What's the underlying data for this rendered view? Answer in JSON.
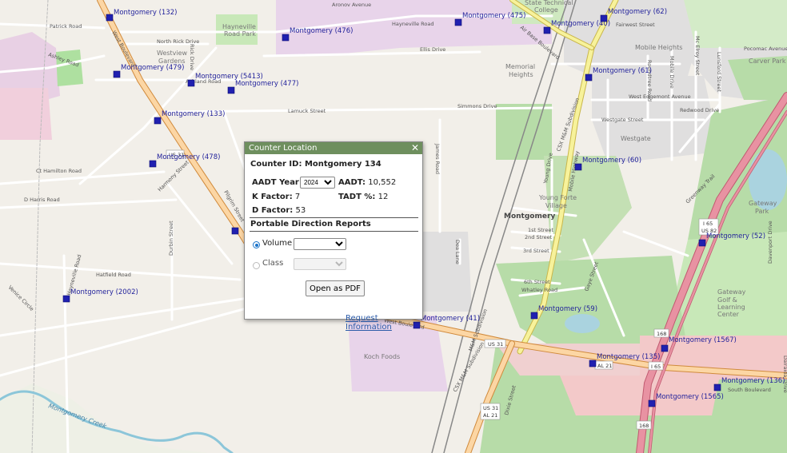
{
  "popup": {
    "title": "Counter Location",
    "close_symbol": "✕",
    "counter_id_label": "Counter ID:",
    "counter_id_value": "Montgomery 134",
    "aadt_year_label": "AADT Year:",
    "aadt_year_selected": "2024",
    "aadt_label": "AADT:",
    "aadt_value": "10,552",
    "k_factor_label": "K Factor:",
    "k_factor_value": "7",
    "tadt_label": "TADT %:",
    "tadt_value": "12",
    "d_factor_label": "D Factor:",
    "d_factor_value": "53",
    "section_title": "Portable Direction Reports",
    "volume_label": "Volume",
    "volume_checked": true,
    "class_label": "Class",
    "class_checked": false,
    "volume_selected": "",
    "class_selected": "",
    "pdf_button_label": "Open as PDF",
    "request_link_label": "Request Information"
  },
  "map": {
    "counters": [
      "Montgomery (132)",
      "Montgomery (476)",
      "Montgomery (475)",
      "Montgomery (40)",
      "Montgomery (62)",
      "Montgomery (479)",
      "Montgomery (5413)",
      "Montgomery (477)",
      "Montgomery (61)",
      "Montgomery (133)",
      "Montgomery (478)",
      "Montgomery (60)",
      "Montgomery (52)",
      "Montgomery (2002)",
      "Montgomery (59)",
      "Montgomery (41)",
      "Montgomery (1567)",
      "Montgomery (135)",
      "Montgomery (136)",
      "Montgomery (1565)"
    ],
    "streets": [
      "Patrick Road",
      "North Rick Drive",
      "Aronov Avenue",
      "Hayneville Road",
      "Ellis Drive",
      "Air Base Boulevard",
      "Fairwest Street",
      "Pocomac Avenue",
      "Lamuck Street",
      "Simmons Drive",
      "West Edgemont Avenue",
      "Westgate Street",
      "Redwood Drive",
      "Hamilton Road",
      "Harmony Street",
      "Pilgrim Street",
      "David Harris Road",
      "Hatfield Road",
      "Durbin Street",
      "James Road",
      "Mobile Highway",
      "Young Drive",
      "Whatley Road",
      "1st Street",
      "2nd Street",
      "3rd Street",
      "6th Street",
      "West Boulevard",
      "South Boulevard",
      "Venice Circle",
      "Rick Drive",
      "Ashley Road",
      "CSX M&M Subdivision",
      "M&M Subdivision",
      "Dea Lane",
      "Lurnford Street",
      "Mobile Drive",
      "Mc Elroy Street",
      "Roundtree Road",
      "Edgemont",
      "Davenport Drive",
      "Dalraida Drive",
      "Ashland Road"
    ],
    "areas": [
      "Hayneville Road Park",
      "Westview Gardens",
      "Memorial Heights",
      "Mobile Heights",
      "Westgate",
      "Young Forte Village",
      "Montgomery",
      "Koch Foods",
      "Gateway Park",
      "Gateway Golf & Learning Center",
      "Carver Park",
      "State Technical College",
      "Montgomery Creek"
    ],
    "shields": [
      "US 31",
      "I 65",
      "US 82",
      "I 68",
      "AL 21",
      "US 31 AL 21",
      "168",
      "I 65"
    ]
  },
  "colors": {
    "popup_header": "#6e8f5e",
    "counter_marker": "#2020b0",
    "motorway": "#e892a2",
    "trunk": "#f9b26e",
    "primary": "#f7e36a",
    "park": "#c8e8b8",
    "residential": "#e0dfdf",
    "industrial": "#e9d3ea",
    "commercial": "#f2d6d6"
  }
}
